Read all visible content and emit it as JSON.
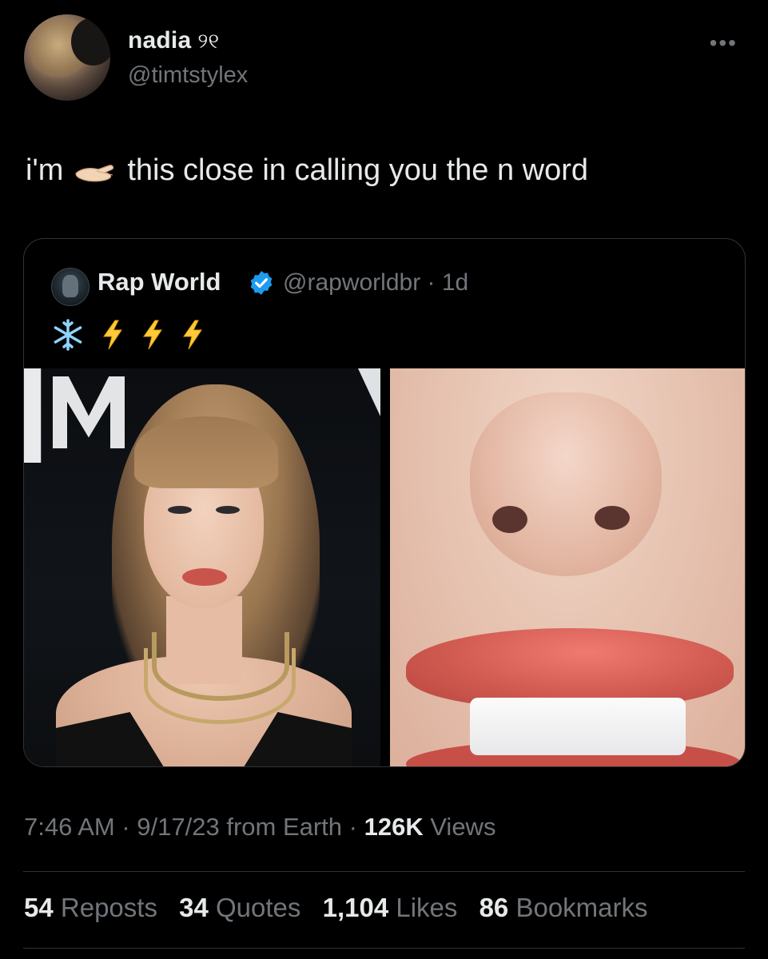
{
  "author": {
    "name": "nadia",
    "name_flair": "୨୧",
    "handle": "@timtstylex"
  },
  "more_icon": "more-horizontal-icon",
  "tweet": {
    "text_before": "i'm",
    "emoji": "pinching-hand-emoji",
    "text_after": "this close in calling you the n word"
  },
  "quoted": {
    "name": "Rap World",
    "verified": true,
    "handle_time": "@rapworldbr · 1d",
    "emojis": [
      "❄️",
      "⚡",
      "⚡",
      "⚡"
    ]
  },
  "meta": {
    "time_date": "7:46 AM · 9/17/23 from Earth · ",
    "views_count": "126K",
    "views_label": " Views"
  },
  "stats": [
    {
      "count": "54",
      "label": "Reposts"
    },
    {
      "count": "34",
      "label": "Quotes"
    },
    {
      "count": "1,104",
      "label": "Likes"
    },
    {
      "count": "86",
      "label": "Bookmarks"
    }
  ],
  "colors": {
    "background": "#000000",
    "text": "#e7e9ea",
    "secondary": "#71767b",
    "border": "#2f3336",
    "verified": "#1d9bf0"
  }
}
